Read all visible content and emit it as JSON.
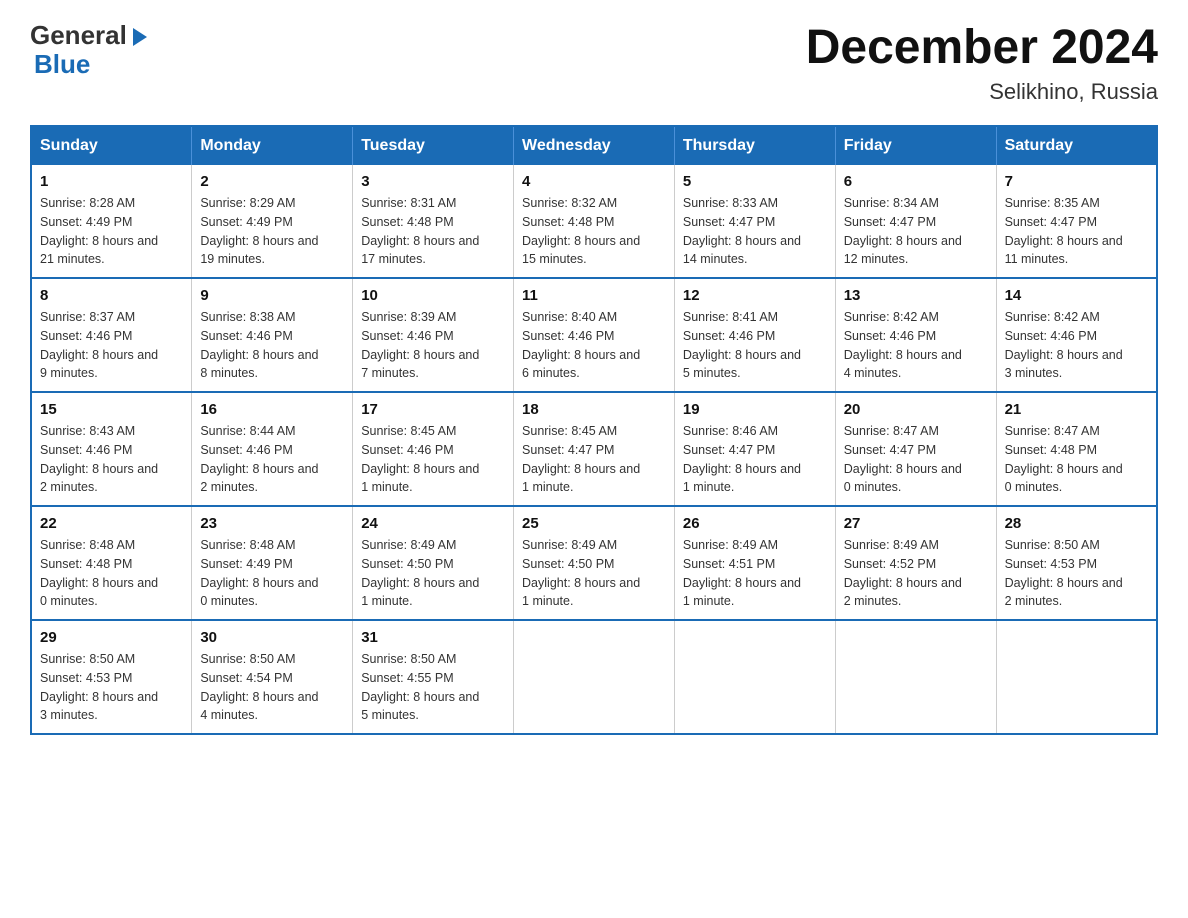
{
  "logo": {
    "line1": "General",
    "arrow": "▶",
    "line2": "Blue"
  },
  "header": {
    "title": "December 2024",
    "subtitle": "Selikhino, Russia"
  },
  "weekdays": [
    "Sunday",
    "Monday",
    "Tuesday",
    "Wednesday",
    "Thursday",
    "Friday",
    "Saturday"
  ],
  "weeks": [
    [
      {
        "day": "1",
        "sunrise": "8:28 AM",
        "sunset": "4:49 PM",
        "daylight": "8 hours and 21 minutes."
      },
      {
        "day": "2",
        "sunrise": "8:29 AM",
        "sunset": "4:49 PM",
        "daylight": "8 hours and 19 minutes."
      },
      {
        "day": "3",
        "sunrise": "8:31 AM",
        "sunset": "4:48 PM",
        "daylight": "8 hours and 17 minutes."
      },
      {
        "day": "4",
        "sunrise": "8:32 AM",
        "sunset": "4:48 PM",
        "daylight": "8 hours and 15 minutes."
      },
      {
        "day": "5",
        "sunrise": "8:33 AM",
        "sunset": "4:47 PM",
        "daylight": "8 hours and 14 minutes."
      },
      {
        "day": "6",
        "sunrise": "8:34 AM",
        "sunset": "4:47 PM",
        "daylight": "8 hours and 12 minutes."
      },
      {
        "day": "7",
        "sunrise": "8:35 AM",
        "sunset": "4:47 PM",
        "daylight": "8 hours and 11 minutes."
      }
    ],
    [
      {
        "day": "8",
        "sunrise": "8:37 AM",
        "sunset": "4:46 PM",
        "daylight": "8 hours and 9 minutes."
      },
      {
        "day": "9",
        "sunrise": "8:38 AM",
        "sunset": "4:46 PM",
        "daylight": "8 hours and 8 minutes."
      },
      {
        "day": "10",
        "sunrise": "8:39 AM",
        "sunset": "4:46 PM",
        "daylight": "8 hours and 7 minutes."
      },
      {
        "day": "11",
        "sunrise": "8:40 AM",
        "sunset": "4:46 PM",
        "daylight": "8 hours and 6 minutes."
      },
      {
        "day": "12",
        "sunrise": "8:41 AM",
        "sunset": "4:46 PM",
        "daylight": "8 hours and 5 minutes."
      },
      {
        "day": "13",
        "sunrise": "8:42 AM",
        "sunset": "4:46 PM",
        "daylight": "8 hours and 4 minutes."
      },
      {
        "day": "14",
        "sunrise": "8:42 AM",
        "sunset": "4:46 PM",
        "daylight": "8 hours and 3 minutes."
      }
    ],
    [
      {
        "day": "15",
        "sunrise": "8:43 AM",
        "sunset": "4:46 PM",
        "daylight": "8 hours and 2 minutes."
      },
      {
        "day": "16",
        "sunrise": "8:44 AM",
        "sunset": "4:46 PM",
        "daylight": "8 hours and 2 minutes."
      },
      {
        "day": "17",
        "sunrise": "8:45 AM",
        "sunset": "4:46 PM",
        "daylight": "8 hours and 1 minute."
      },
      {
        "day": "18",
        "sunrise": "8:45 AM",
        "sunset": "4:47 PM",
        "daylight": "8 hours and 1 minute."
      },
      {
        "day": "19",
        "sunrise": "8:46 AM",
        "sunset": "4:47 PM",
        "daylight": "8 hours and 1 minute."
      },
      {
        "day": "20",
        "sunrise": "8:47 AM",
        "sunset": "4:47 PM",
        "daylight": "8 hours and 0 minutes."
      },
      {
        "day": "21",
        "sunrise": "8:47 AM",
        "sunset": "4:48 PM",
        "daylight": "8 hours and 0 minutes."
      }
    ],
    [
      {
        "day": "22",
        "sunrise": "8:48 AM",
        "sunset": "4:48 PM",
        "daylight": "8 hours and 0 minutes."
      },
      {
        "day": "23",
        "sunrise": "8:48 AM",
        "sunset": "4:49 PM",
        "daylight": "8 hours and 0 minutes."
      },
      {
        "day": "24",
        "sunrise": "8:49 AM",
        "sunset": "4:50 PM",
        "daylight": "8 hours and 1 minute."
      },
      {
        "day": "25",
        "sunrise": "8:49 AM",
        "sunset": "4:50 PM",
        "daylight": "8 hours and 1 minute."
      },
      {
        "day": "26",
        "sunrise": "8:49 AM",
        "sunset": "4:51 PM",
        "daylight": "8 hours and 1 minute."
      },
      {
        "day": "27",
        "sunrise": "8:49 AM",
        "sunset": "4:52 PM",
        "daylight": "8 hours and 2 minutes."
      },
      {
        "day": "28",
        "sunrise": "8:50 AM",
        "sunset": "4:53 PM",
        "daylight": "8 hours and 2 minutes."
      }
    ],
    [
      {
        "day": "29",
        "sunrise": "8:50 AM",
        "sunset": "4:53 PM",
        "daylight": "8 hours and 3 minutes."
      },
      {
        "day": "30",
        "sunrise": "8:50 AM",
        "sunset": "4:54 PM",
        "daylight": "8 hours and 4 minutes."
      },
      {
        "day": "31",
        "sunrise": "8:50 AM",
        "sunset": "4:55 PM",
        "daylight": "8 hours and 5 minutes."
      },
      null,
      null,
      null,
      null
    ]
  ]
}
